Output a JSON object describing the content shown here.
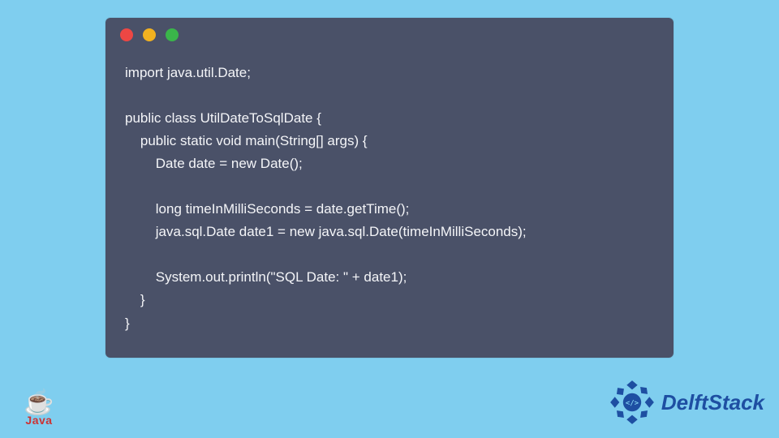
{
  "window": {
    "dots": [
      "red",
      "yellow",
      "green"
    ]
  },
  "code": {
    "lines": [
      "import java.util.Date;",
      "",
      "public class UtilDateToSqlDate {",
      "    public static void main(String[] args) {",
      "        Date date = new Date();",
      "",
      "        long timeInMilliSeconds = date.getTime();",
      "        java.sql.Date date1 = new java.sql.Date(timeInMilliSeconds);",
      "",
      "        System.out.println(\"SQL Date: \" + date1);",
      "    }",
      "}"
    ]
  },
  "logos": {
    "java": {
      "glyph": "☕",
      "label": "Java"
    },
    "delftstack": {
      "label": "DelftStack",
      "tag_glyph": "</>"
    }
  }
}
